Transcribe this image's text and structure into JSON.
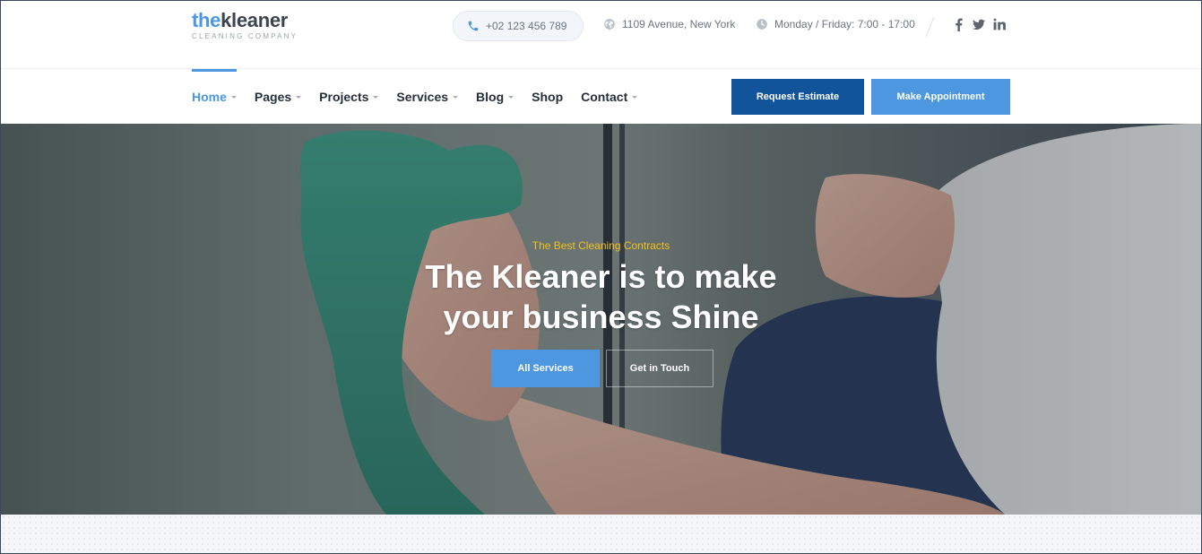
{
  "brand": {
    "name_prefix": "the",
    "name_rest": "kleaner",
    "tagline": "CLEANING COMPANY",
    "accent": "#4c97e0",
    "dark": "#12549a"
  },
  "contact": {
    "phone": "+02 123 456 789",
    "address": "1109 Avenue, New York",
    "hours": "Monday / Friday: 7:00 - 17:00"
  },
  "social": [
    "facebook-icon",
    "twitter-icon",
    "linkedin-icon"
  ],
  "nav": {
    "items": [
      {
        "label": "Home",
        "dropdown": true,
        "active": true
      },
      {
        "label": "Pages",
        "dropdown": true
      },
      {
        "label": "Projects",
        "dropdown": true
      },
      {
        "label": "Services",
        "dropdown": true
      },
      {
        "label": "Blog",
        "dropdown": true
      },
      {
        "label": "Shop",
        "dropdown": false
      },
      {
        "label": "Contact",
        "dropdown": true
      }
    ],
    "request_estimate": "Request Estimate",
    "make_appointment": "Make Appointment"
  },
  "hero": {
    "tagline": "The Best Cleaning Contracts",
    "title_line1": "The Kleaner is to make",
    "title_line2": "your business Shine",
    "primary_button": "All Services",
    "secondary_button": "Get in Touch",
    "tagline_color": "#f2c21a"
  }
}
